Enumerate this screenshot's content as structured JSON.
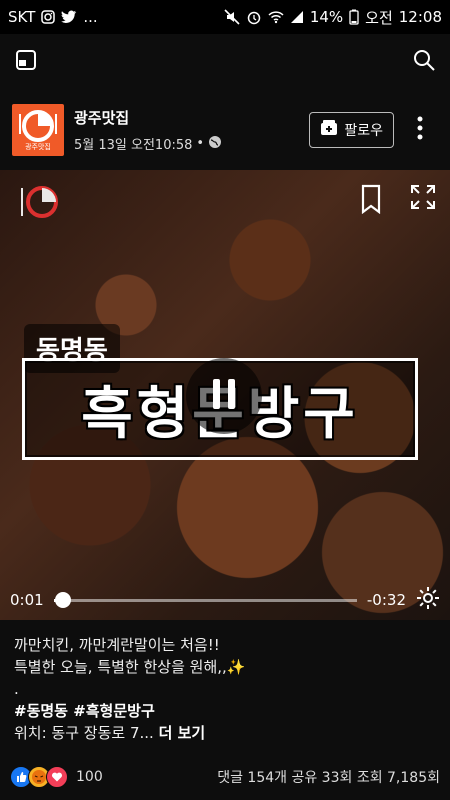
{
  "status_bar": {
    "carrier": "SKT",
    "ellipsis": "...",
    "battery": "14%",
    "ampm": "오전",
    "time": "12:08",
    "icons": [
      "instagram-icon",
      "twitter-icon",
      "mute-icon",
      "alarm-icon",
      "wifi-icon",
      "signal-icon",
      "battery-icon"
    ]
  },
  "post": {
    "page_name": "광주맛집",
    "avatar_label": "광주맛집",
    "timestamp": "5월 13일 오전10:58",
    "follow_label": "팔로우"
  },
  "video": {
    "place": "동명동",
    "title": "흑형문방구",
    "current_time": "0:01",
    "remaining_time": "-0:32",
    "progress": 0.03
  },
  "caption": {
    "line1": "까만치킨, 까만계란말이는 처음!!",
    "line2": "특별한 오늘, 특별한 한상을 원해,,✨",
    "line3": ".",
    "hashtags": "#동명동 #흑형문방구",
    "location_prefix": "위치: 동구 장동로 7...",
    "more_label": "더 보기"
  },
  "reactions": {
    "count": "100",
    "stats": "댓글 154개 공유 33회 조회 7,185회"
  },
  "colors": {
    "brand_orange": "#f05a28",
    "like_blue": "#1877f2",
    "angry_orange": "#f7b125",
    "love_red": "#f33e58"
  }
}
